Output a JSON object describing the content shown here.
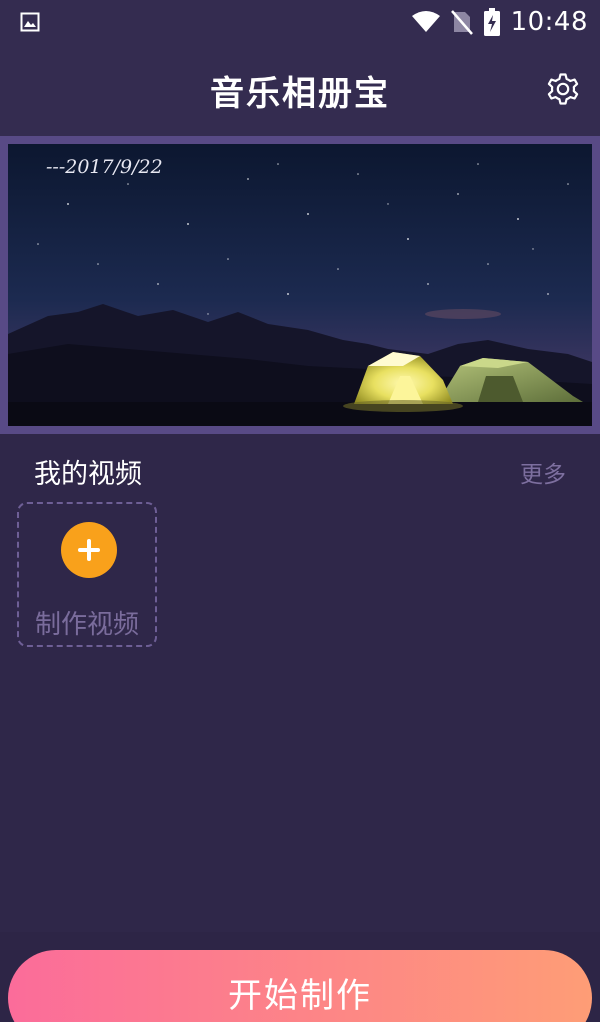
{
  "status_bar": {
    "time": "10:48",
    "icons": [
      "gallery-notification-icon",
      "wifi-icon",
      "no-sim-icon",
      "battery-charging-icon"
    ]
  },
  "app_bar": {
    "title": "音乐相册宝",
    "settings_icon": "gear-icon"
  },
  "banner": {
    "date_text": "---2017/9/22",
    "scene": "night-sky-tents"
  },
  "my_videos": {
    "title": "我的视频",
    "more_label": "更多",
    "create_card": {
      "label": "制作视频",
      "icon": "plus-icon"
    }
  },
  "bottom": {
    "start_label": "开始制作"
  },
  "colors": {
    "background": "#2f2749",
    "header": "#342c50",
    "accent_orange": "#f9a11b",
    "gradient_start": "#fb6c9a",
    "gradient_end": "#fe9d76",
    "muted_text": "#7d6f9f"
  }
}
